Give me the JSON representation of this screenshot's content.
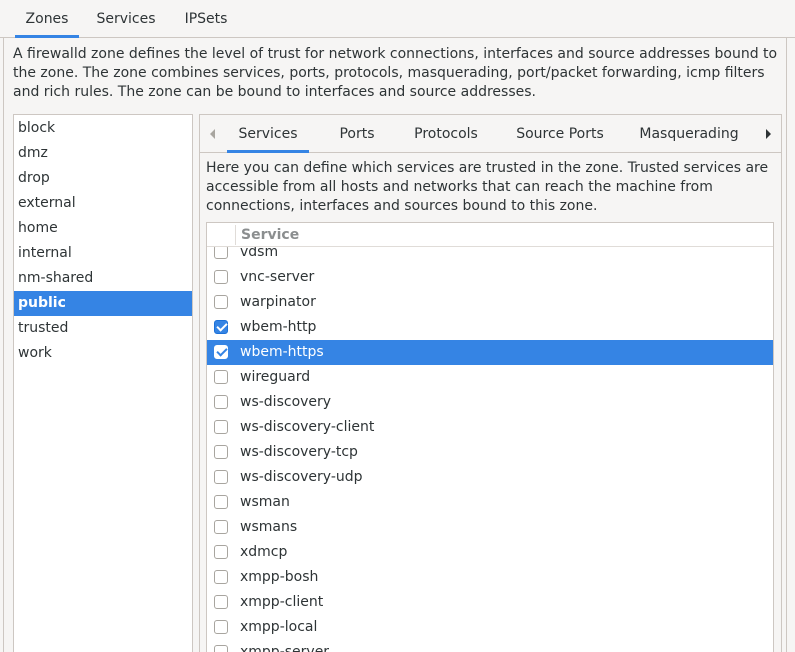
{
  "top_tabs": [
    {
      "label": "Zones",
      "active": true
    },
    {
      "label": "Services",
      "active": false
    },
    {
      "label": "IPSets",
      "active": false
    }
  ],
  "zone_description": "A firewalld zone defines the level of trust for network connections, interfaces and source addresses bound to the zone. The zone combines services, ports, protocols, masquerading, port/packet forwarding, icmp filters and rich rules. The zone can be bound to interfaces and source addresses.",
  "zones": [
    "block",
    "dmz",
    "drop",
    "external",
    "home",
    "internal",
    "nm-shared",
    "public",
    "trusted",
    "work"
  ],
  "selected_zone": "public",
  "sub_tabs": [
    {
      "label": "Services",
      "active": true
    },
    {
      "label": "Ports",
      "active": false
    },
    {
      "label": "Protocols",
      "active": false
    },
    {
      "label": "Source Ports",
      "active": false
    },
    {
      "label": "Masquerading",
      "active": false
    }
  ],
  "services_description": "Here you can define which services are trusted in the zone. Trusted services are accessible from all hosts and networks that can reach the machine from connections, interfaces and sources bound to this zone.",
  "services_table": {
    "column_header": "Service",
    "rows": [
      {
        "name": "vdsm",
        "checked": false,
        "selected": false
      },
      {
        "name": "vnc-server",
        "checked": false,
        "selected": false
      },
      {
        "name": "warpinator",
        "checked": false,
        "selected": false
      },
      {
        "name": "wbem-http",
        "checked": true,
        "selected": false
      },
      {
        "name": "wbem-https",
        "checked": true,
        "selected": true
      },
      {
        "name": "wireguard",
        "checked": false,
        "selected": false
      },
      {
        "name": "ws-discovery",
        "checked": false,
        "selected": false
      },
      {
        "name": "ws-discovery-client",
        "checked": false,
        "selected": false
      },
      {
        "name": "ws-discovery-tcp",
        "checked": false,
        "selected": false
      },
      {
        "name": "ws-discovery-udp",
        "checked": false,
        "selected": false
      },
      {
        "name": "wsman",
        "checked": false,
        "selected": false
      },
      {
        "name": "wsmans",
        "checked": false,
        "selected": false
      },
      {
        "name": "xdmcp",
        "checked": false,
        "selected": false
      },
      {
        "name": "xmpp-bosh",
        "checked": false,
        "selected": false
      },
      {
        "name": "xmpp-client",
        "checked": false,
        "selected": false
      },
      {
        "name": "xmpp-local",
        "checked": false,
        "selected": false
      },
      {
        "name": "xmpp-server",
        "checked": false,
        "selected": false
      }
    ]
  },
  "colors": {
    "accent": "#3584e4",
    "background": "#f6f5f4",
    "border": "#cdc7c2"
  },
  "icons": {
    "tab_scroll_left": "triangle-left-icon",
    "tab_scroll_right": "triangle-right-icon"
  }
}
